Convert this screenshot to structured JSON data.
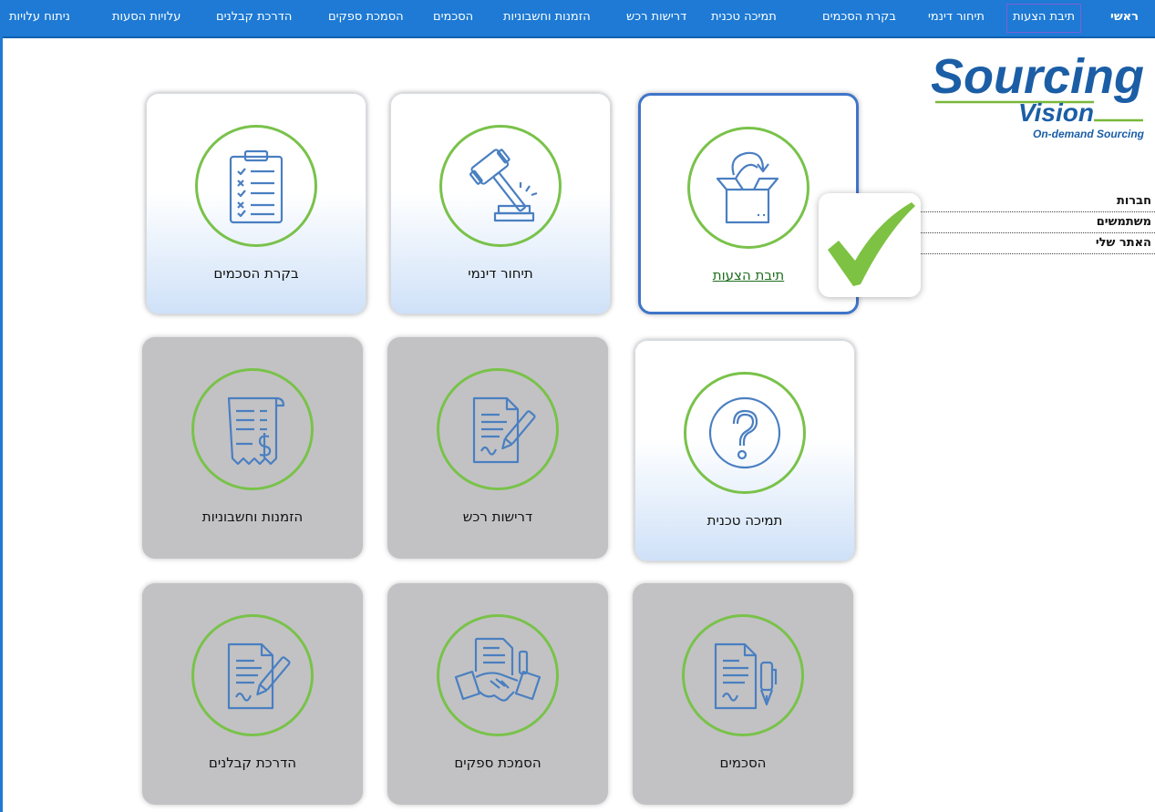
{
  "nav": {
    "home": "ראשי",
    "items": [
      "תיבת הצעות",
      "תיחור דינמי",
      "בקרת הסכמים",
      "תמיכה טכנית",
      "דרישות רכש",
      "הזמנות וחשבוניות",
      "הסכמים",
      "הסמכת ספקים",
      "הדרכת קבלנים",
      "עלויות הסעות",
      "ניתוח עלויות"
    ]
  },
  "logo": {
    "line1": "Sourcing",
    "line2": "Vision",
    "tagline": "On-demand Sourcing"
  },
  "side_menu": [
    "חברות",
    "משתמשים",
    "האתר שלי"
  ],
  "tiles": [
    {
      "label": "תיבת הצעות",
      "icon": "box-icon",
      "style": "selected"
    },
    {
      "label": "תיחור דינמי",
      "icon": "gavel-icon",
      "style": "light"
    },
    {
      "label": "בקרת הסכמים",
      "icon": "clipboard-checklist-icon",
      "style": "light"
    },
    {
      "label": "תמיכה טכנית",
      "icon": "question-mark-icon",
      "style": "light"
    },
    {
      "label": "דרישות רכש",
      "icon": "document-pen-icon",
      "style": "gray"
    },
    {
      "label": "הזמנות וחשבוניות",
      "icon": "receipt-dollar-icon",
      "style": "gray"
    },
    {
      "label": "הסכמים",
      "icon": "document-fountain-pen-icon",
      "style": "gray"
    },
    {
      "label": "הסמכת ספקים",
      "icon": "handshake-document-icon",
      "style": "gray"
    },
    {
      "label": "הדרכת קבלנים",
      "icon": "document-signing-icon",
      "style": "gray"
    }
  ],
  "colors": {
    "nav_bg": "#1e7ad4",
    "ring": "#79c24a",
    "icon": "#4a7fc1",
    "check": "#7dc242",
    "selected_border": "#3f75c9"
  }
}
